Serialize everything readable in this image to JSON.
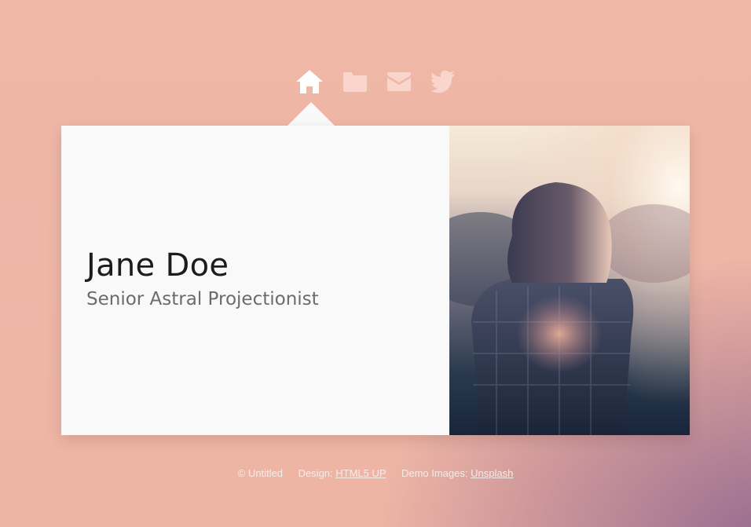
{
  "nav": {
    "items": [
      {
        "name": "home",
        "icon": "home-icon",
        "active": true
      },
      {
        "name": "work",
        "icon": "folder-icon",
        "active": false
      },
      {
        "name": "contact",
        "icon": "envelope-icon",
        "active": false
      },
      {
        "name": "twitter",
        "icon": "twitter-icon",
        "active": false
      }
    ]
  },
  "profile": {
    "name": "Jane Doe",
    "title": "Senior Astral Projectionist"
  },
  "footer": {
    "copyright": "© Untitled",
    "design_label": "Design:",
    "design_link": "HTML5 UP",
    "images_label": "Demo Images:",
    "images_link": "Unsplash"
  },
  "colors": {
    "background": "#efb7a6",
    "card": "#f9f9f9",
    "name_text": "#1c1c1c",
    "title_text": "#6b6b6b",
    "active_icon": "#ffffff"
  }
}
